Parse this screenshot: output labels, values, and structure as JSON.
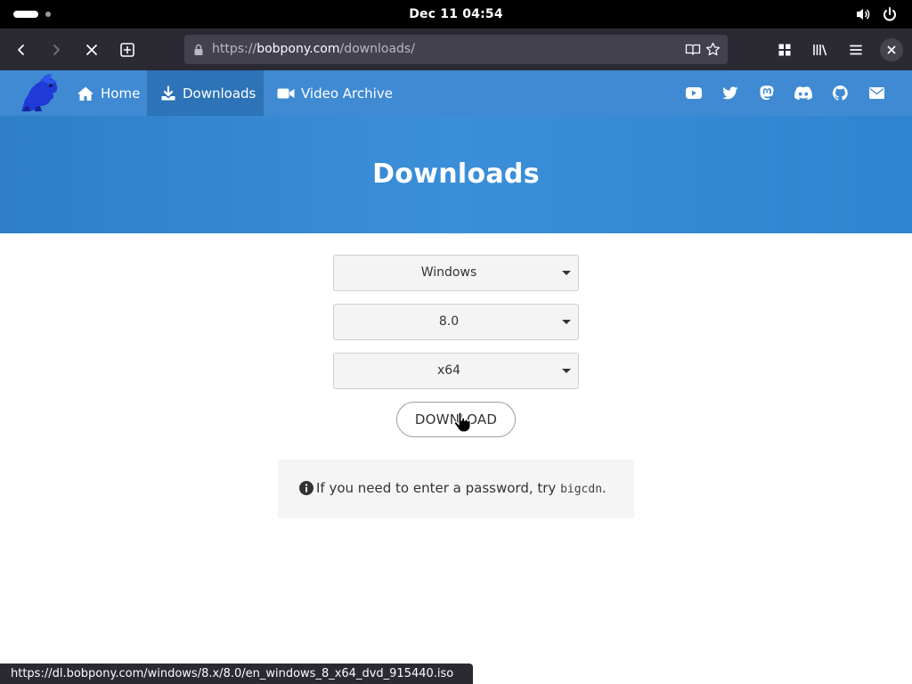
{
  "system": {
    "clock": "Dec 11  04:54"
  },
  "browser": {
    "url_prefix": "https://",
    "url_host": "bobpony.com",
    "url_path": "/downloads/",
    "status_url": "https://dl.bobpony.com/windows/8.x/8.0/en_windows_8_x64_dvd_915440.iso"
  },
  "nav": {
    "home": "Home",
    "downloads": "Downloads",
    "video_archive": "Video Archive"
  },
  "hero": {
    "title": "Downloads"
  },
  "form": {
    "os": "Windows",
    "version": "8.0",
    "arch": "x64",
    "download_label": "DOWNLOAD"
  },
  "notice": {
    "text": "If you need to enter a password, try ",
    "password": "bigcdn",
    "suffix": "."
  },
  "colors": {
    "nav_bg": "#3f8ad2",
    "nav_active": "#2d73b8",
    "hero_bg": "#3b8fd8",
    "toolbar_bg": "#2b2a33"
  }
}
